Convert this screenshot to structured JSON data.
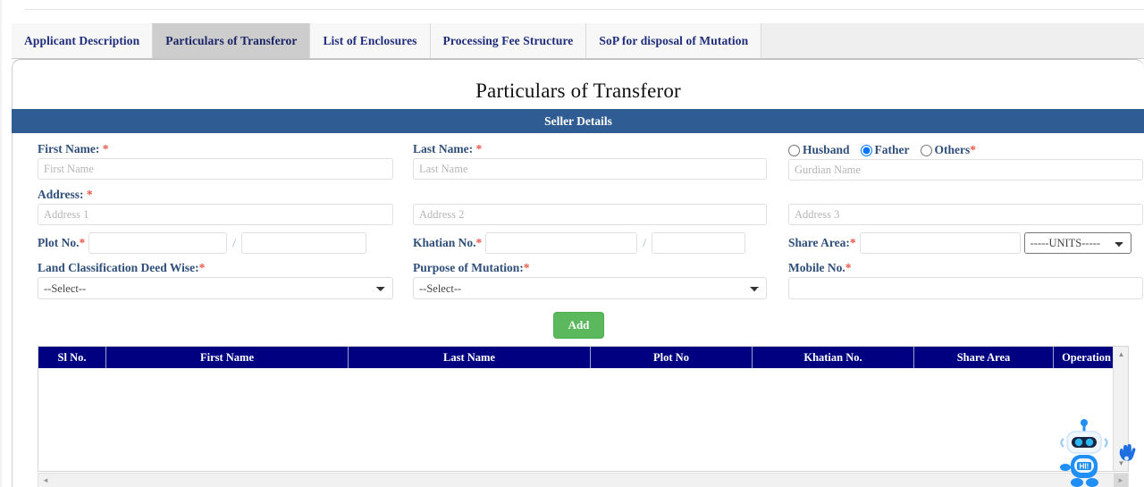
{
  "tabs": [
    {
      "label": "Applicant Description",
      "active": false
    },
    {
      "label": "Particulars of Transferor",
      "active": true
    },
    {
      "label": "List of Enclosures",
      "active": false
    },
    {
      "label": "Processing Fee Structure",
      "active": false
    },
    {
      "label": "SoP for disposal of Mutation",
      "active": false
    }
  ],
  "page": {
    "title": "Particulars of Transferor",
    "section_bar": "Seller Details"
  },
  "form": {
    "first_name": {
      "label": "First Name:",
      "required": "*",
      "placeholder": "First Name",
      "value": ""
    },
    "last_name": {
      "label": "Last Name:",
      "required": "*",
      "placeholder": "Last Name",
      "value": ""
    },
    "guardian": {
      "options": [
        "Husband",
        "Father",
        "Others"
      ],
      "selected": "Father",
      "required": "*",
      "placeholder": "Gurdian Name",
      "value": ""
    },
    "address": {
      "label": "Address:",
      "required": "*",
      "placeholder_1": "Address 1",
      "placeholder_2": "Address 2",
      "placeholder_3": "Address 3",
      "value_1": "",
      "value_2": "",
      "value_3": ""
    },
    "plot_no": {
      "label": "Plot No.",
      "required": "*",
      "value_1": "",
      "value_2": "",
      "separator": "/"
    },
    "khatian_no": {
      "label": "Khatian No.",
      "required": "*",
      "value_1": "",
      "value_2": "",
      "separator": "/"
    },
    "share_area": {
      "label": "Share Area:",
      "required": "*",
      "value": ""
    },
    "units": {
      "selected": "-----UNITS-----",
      "options": [
        "-----UNITS-----"
      ]
    },
    "land_classification": {
      "label": "Land Classification Deed Wise:",
      "required": "*",
      "selected": "--Select--",
      "options": [
        "--Select--"
      ]
    },
    "purpose_of_mutation": {
      "label": "Purpose of Mutation:",
      "required": "*",
      "selected": "--Select--",
      "options": [
        "--Select--"
      ]
    },
    "mobile_no": {
      "label": "Mobile No.",
      "required": "*",
      "value": ""
    },
    "add_button": "Add"
  },
  "table": {
    "columns": [
      "Sl No.",
      "First Name",
      "Last Name",
      "Plot No",
      "Khatian No.",
      "Share Area",
      "Operation"
    ],
    "rows": []
  },
  "icons": {
    "chatbot": "chatbot-robot-icon",
    "chatbot_text": "HI!",
    "scroll_up": "▲",
    "scroll_down": "▼",
    "scroll_left": "◄",
    "scroll_right": "►"
  },
  "colors": {
    "section_bar": "#2f5c92",
    "table_header": "#000080",
    "add_button": "#5cb85c",
    "label": "#2f4f7a",
    "required": "#e8574a",
    "tab_text": "#1f2d7a",
    "tab_active_bg": "#cdcdcd"
  }
}
